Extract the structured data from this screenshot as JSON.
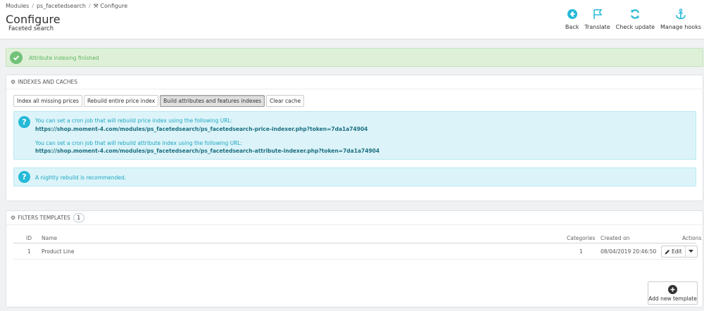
{
  "breadcrumb": [
    "Modules",
    "ps_facetedsearch",
    "Configure"
  ],
  "header": {
    "title": "Configure",
    "subtitle": "Faceted search"
  },
  "toolbar": [
    {
      "label": "Back",
      "icon": "back-arrow-circle-icon"
    },
    {
      "label": "Translate",
      "icon": "flag-icon"
    },
    {
      "label": "Check update",
      "icon": "refresh-icon"
    },
    {
      "label": "Manage hooks",
      "icon": "anchor-icon"
    }
  ],
  "alert": {
    "text": "Attribute indexing finished",
    "icon": "check-circle-icon"
  },
  "indexes_panel": {
    "heading": "Indexes and caches",
    "buttons": [
      "Index all missing prices",
      "Rebuild entire price index",
      "Build attributes and features indexes",
      "Clear cache"
    ],
    "info_lines": [
      "You can set a cron job that will rebuild price index using the following URL:",
      "https://shop.moment-4.com/modules/ps_facetedsearch/ps_facetedsearch-price-indexer.php?token=7da1a74904",
      "You can set a cron job that will rebuild attribute index using the following URL:",
      "https://shop.moment-4.com/modules/ps_facetedsearch/ps_facetedsearch-attribute-indexer.php?token=7da1a74904"
    ],
    "nightly_text": "A nightly rebuild is recommended."
  },
  "templates_panel": {
    "heading": "Filters templates",
    "count": "1",
    "columns": {
      "id": "ID",
      "name": "Name",
      "categories": "Categories",
      "created": "Created on",
      "actions": "Actions"
    },
    "rows": [
      {
        "id": "1",
        "name": "Product Line",
        "categories": "1",
        "created": "08/04/2019 20:46:50",
        "action": "Edit"
      }
    ],
    "add_label": "Add new template"
  },
  "colors": {
    "accent": "#25b9d7",
    "success_bg": "#dff0d8",
    "success_icon": "#72c279",
    "info_bg": "#dcf4f9"
  }
}
